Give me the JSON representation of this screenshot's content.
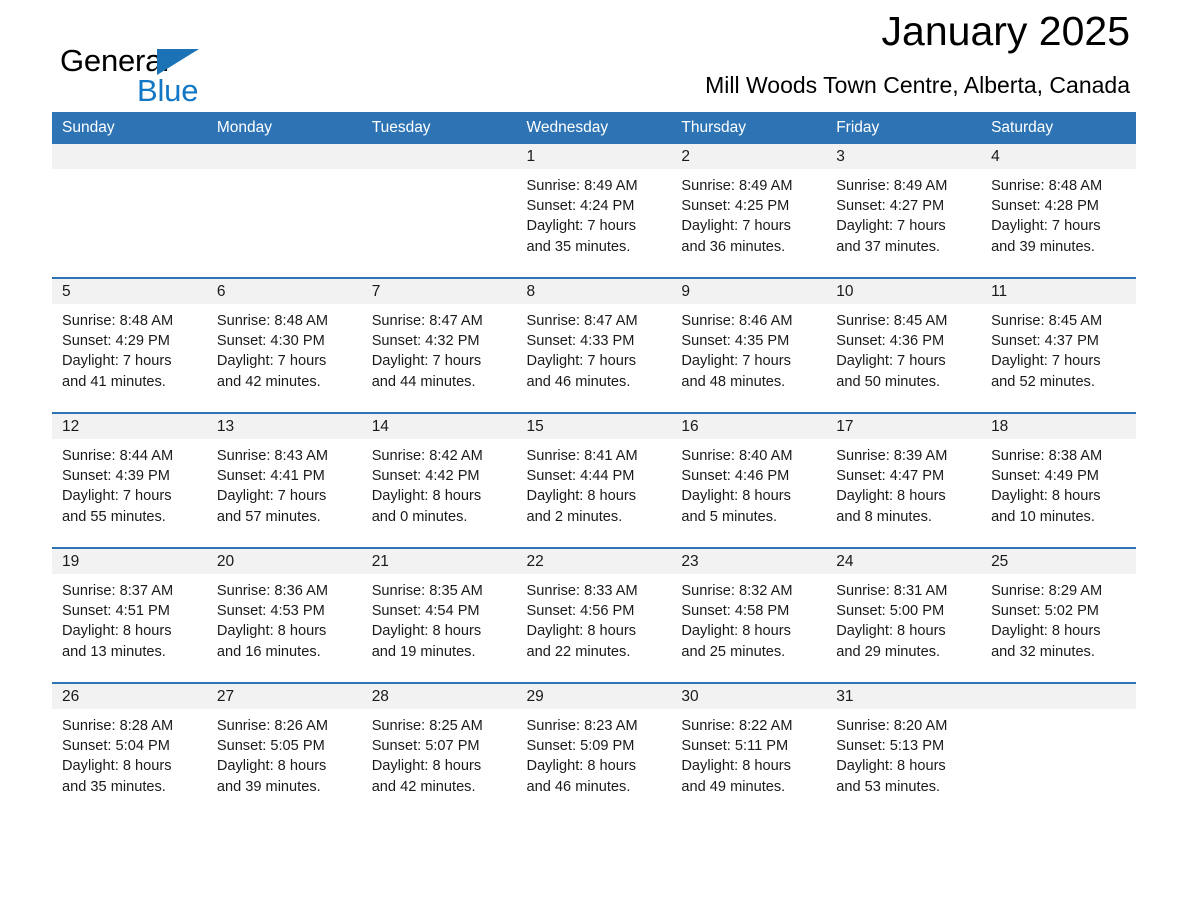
{
  "brand": {
    "name_part1": "General",
    "name_part2": "Blue",
    "triangle_icon": "blue-triangle-logo-mark",
    "accent_color": "#1B72B5",
    "blue_text_color": "#1277C4"
  },
  "header": {
    "month_title": "January 2025",
    "location": "Mill Woods Town Centre, Alberta, Canada",
    "header_bg_color": "#2E74B5",
    "daynum_bg_color": "#F2F2F2"
  },
  "weekday_headers": [
    "Sunday",
    "Monday",
    "Tuesday",
    "Wednesday",
    "Thursday",
    "Friday",
    "Saturday"
  ],
  "labels": {
    "sunrise_prefix": "Sunrise:",
    "sunset_prefix": "Sunset:",
    "daylight_prefix": "Daylight:"
  },
  "weeks": [
    {
      "days": [
        {
          "day": "",
          "line1": "",
          "line2": "",
          "line3": "",
          "line4": "",
          "empty": true
        },
        {
          "day": "",
          "line1": "",
          "line2": "",
          "line3": "",
          "line4": "",
          "empty": true
        },
        {
          "day": "",
          "line1": "",
          "line2": "",
          "line3": "",
          "line4": "",
          "empty": true
        },
        {
          "day": "1",
          "line1": "Sunrise: 8:49 AM",
          "line2": "Sunset: 4:24 PM",
          "line3": "Daylight: 7 hours",
          "line4": "and 35 minutes.",
          "empty": false
        },
        {
          "day": "2",
          "line1": "Sunrise: 8:49 AM",
          "line2": "Sunset: 4:25 PM",
          "line3": "Daylight: 7 hours",
          "line4": "and 36 minutes.",
          "empty": false
        },
        {
          "day": "3",
          "line1": "Sunrise: 8:49 AM",
          "line2": "Sunset: 4:27 PM",
          "line3": "Daylight: 7 hours",
          "line4": "and 37 minutes.",
          "empty": false
        },
        {
          "day": "4",
          "line1": "Sunrise: 8:48 AM",
          "line2": "Sunset: 4:28 PM",
          "line3": "Daylight: 7 hours",
          "line4": "and 39 minutes.",
          "empty": false
        }
      ]
    },
    {
      "days": [
        {
          "day": "5",
          "line1": "Sunrise: 8:48 AM",
          "line2": "Sunset: 4:29 PM",
          "line3": "Daylight: 7 hours",
          "line4": "and 41 minutes.",
          "empty": false
        },
        {
          "day": "6",
          "line1": "Sunrise: 8:48 AM",
          "line2": "Sunset: 4:30 PM",
          "line3": "Daylight: 7 hours",
          "line4": "and 42 minutes.",
          "empty": false
        },
        {
          "day": "7",
          "line1": "Sunrise: 8:47 AM",
          "line2": "Sunset: 4:32 PM",
          "line3": "Daylight: 7 hours",
          "line4": "and 44 minutes.",
          "empty": false
        },
        {
          "day": "8",
          "line1": "Sunrise: 8:47 AM",
          "line2": "Sunset: 4:33 PM",
          "line3": "Daylight: 7 hours",
          "line4": "and 46 minutes.",
          "empty": false
        },
        {
          "day": "9",
          "line1": "Sunrise: 8:46 AM",
          "line2": "Sunset: 4:35 PM",
          "line3": "Daylight: 7 hours",
          "line4": "and 48 minutes.",
          "empty": false
        },
        {
          "day": "10",
          "line1": "Sunrise: 8:45 AM",
          "line2": "Sunset: 4:36 PM",
          "line3": "Daylight: 7 hours",
          "line4": "and 50 minutes.",
          "empty": false
        },
        {
          "day": "11",
          "line1": "Sunrise: 8:45 AM",
          "line2": "Sunset: 4:37 PM",
          "line3": "Daylight: 7 hours",
          "line4": "and 52 minutes.",
          "empty": false
        }
      ]
    },
    {
      "days": [
        {
          "day": "12",
          "line1": "Sunrise: 8:44 AM",
          "line2": "Sunset: 4:39 PM",
          "line3": "Daylight: 7 hours",
          "line4": "and 55 minutes.",
          "empty": false
        },
        {
          "day": "13",
          "line1": "Sunrise: 8:43 AM",
          "line2": "Sunset: 4:41 PM",
          "line3": "Daylight: 7 hours",
          "line4": "and 57 minutes.",
          "empty": false
        },
        {
          "day": "14",
          "line1": "Sunrise: 8:42 AM",
          "line2": "Sunset: 4:42 PM",
          "line3": "Daylight: 8 hours",
          "line4": "and 0 minutes.",
          "empty": false
        },
        {
          "day": "15",
          "line1": "Sunrise: 8:41 AM",
          "line2": "Sunset: 4:44 PM",
          "line3": "Daylight: 8 hours",
          "line4": "and 2 minutes.",
          "empty": false
        },
        {
          "day": "16",
          "line1": "Sunrise: 8:40 AM",
          "line2": "Sunset: 4:46 PM",
          "line3": "Daylight: 8 hours",
          "line4": "and 5 minutes.",
          "empty": false
        },
        {
          "day": "17",
          "line1": "Sunrise: 8:39 AM",
          "line2": "Sunset: 4:47 PM",
          "line3": "Daylight: 8 hours",
          "line4": "and 8 minutes.",
          "empty": false
        },
        {
          "day": "18",
          "line1": "Sunrise: 8:38 AM",
          "line2": "Sunset: 4:49 PM",
          "line3": "Daylight: 8 hours",
          "line4": "and 10 minutes.",
          "empty": false
        }
      ]
    },
    {
      "days": [
        {
          "day": "19",
          "line1": "Sunrise: 8:37 AM",
          "line2": "Sunset: 4:51 PM",
          "line3": "Daylight: 8 hours",
          "line4": "and 13 minutes.",
          "empty": false
        },
        {
          "day": "20",
          "line1": "Sunrise: 8:36 AM",
          "line2": "Sunset: 4:53 PM",
          "line3": "Daylight: 8 hours",
          "line4": "and 16 minutes.",
          "empty": false
        },
        {
          "day": "21",
          "line1": "Sunrise: 8:35 AM",
          "line2": "Sunset: 4:54 PM",
          "line3": "Daylight: 8 hours",
          "line4": "and 19 minutes.",
          "empty": false
        },
        {
          "day": "22",
          "line1": "Sunrise: 8:33 AM",
          "line2": "Sunset: 4:56 PM",
          "line3": "Daylight: 8 hours",
          "line4": "and 22 minutes.",
          "empty": false
        },
        {
          "day": "23",
          "line1": "Sunrise: 8:32 AM",
          "line2": "Sunset: 4:58 PM",
          "line3": "Daylight: 8 hours",
          "line4": "and 25 minutes.",
          "empty": false
        },
        {
          "day": "24",
          "line1": "Sunrise: 8:31 AM",
          "line2": "Sunset: 5:00 PM",
          "line3": "Daylight: 8 hours",
          "line4": "and 29 minutes.",
          "empty": false
        },
        {
          "day": "25",
          "line1": "Sunrise: 8:29 AM",
          "line2": "Sunset: 5:02 PM",
          "line3": "Daylight: 8 hours",
          "line4": "and 32 minutes.",
          "empty": false
        }
      ]
    },
    {
      "days": [
        {
          "day": "26",
          "line1": "Sunrise: 8:28 AM",
          "line2": "Sunset: 5:04 PM",
          "line3": "Daylight: 8 hours",
          "line4": "and 35 minutes.",
          "empty": false
        },
        {
          "day": "27",
          "line1": "Sunrise: 8:26 AM",
          "line2": "Sunset: 5:05 PM",
          "line3": "Daylight: 8 hours",
          "line4": "and 39 minutes.",
          "empty": false
        },
        {
          "day": "28",
          "line1": "Sunrise: 8:25 AM",
          "line2": "Sunset: 5:07 PM",
          "line3": "Daylight: 8 hours",
          "line4": "and 42 minutes.",
          "empty": false
        },
        {
          "day": "29",
          "line1": "Sunrise: 8:23 AM",
          "line2": "Sunset: 5:09 PM",
          "line3": "Daylight: 8 hours",
          "line4": "and 46 minutes.",
          "empty": false
        },
        {
          "day": "30",
          "line1": "Sunrise: 8:22 AM",
          "line2": "Sunset: 5:11 PM",
          "line3": "Daylight: 8 hours",
          "line4": "and 49 minutes.",
          "empty": false
        },
        {
          "day": "31",
          "line1": "Sunrise: 8:20 AM",
          "line2": "Sunset: 5:13 PM",
          "line3": "Daylight: 8 hours",
          "line4": "and 53 minutes.",
          "empty": false
        },
        {
          "day": "",
          "line1": "",
          "line2": "",
          "line3": "",
          "line4": "",
          "empty": true
        }
      ]
    }
  ]
}
